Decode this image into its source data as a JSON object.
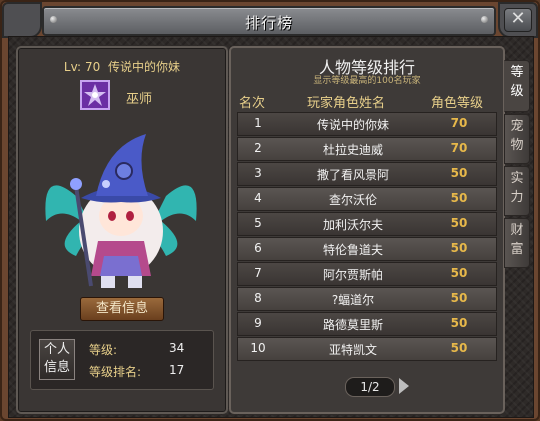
{
  "window": {
    "title": "排行榜"
  },
  "player": {
    "lv_label": "Lv:",
    "level": "70",
    "name": "传说中的你妹",
    "class_icon": "class-emblem-icon",
    "class_name": "巫师",
    "view_info_label": "查看信息",
    "personal_info_label": "个人信息",
    "level_label": "等级:",
    "level_value": "34",
    "rank_label": "等级排名:",
    "rank_value": "17"
  },
  "ranking": {
    "title": "人物等级排行",
    "subtitle": "显示等级最高的100名玩家",
    "columns": [
      "名次",
      "玩家角色姓名",
      "角色等级"
    ],
    "rows": [
      {
        "rank": "1",
        "name": "传说中的你妹",
        "level": "70"
      },
      {
        "rank": "2",
        "name": "杜拉史迪威",
        "level": "70"
      },
      {
        "rank": "3",
        "name": "撒了看风景阿",
        "level": "50"
      },
      {
        "rank": "4",
        "name": "查尔沃伦",
        "level": "50"
      },
      {
        "rank": "5",
        "name": "加利沃尔夫",
        "level": "50"
      },
      {
        "rank": "6",
        "name": "特伦鲁道夫",
        "level": "50"
      },
      {
        "rank": "7",
        "name": "阿尔贾斯帕",
        "level": "50"
      },
      {
        "rank": "8",
        "name": "?蝠道尔",
        "level": "50"
      },
      {
        "rank": "9",
        "name": "路德莫里斯",
        "level": "50"
      },
      {
        "rank": "10",
        "name": "亚特凯文",
        "level": "50"
      }
    ],
    "page": "1/2"
  },
  "tabs": [
    {
      "label": "等级",
      "active": true
    },
    {
      "label": "宠物",
      "active": false
    },
    {
      "label": "实力",
      "active": false
    },
    {
      "label": "财富",
      "active": false
    }
  ],
  "colors": {
    "accent": "#e7b84a",
    "label": "#e7cf8a",
    "frame": "#6b4630"
  }
}
